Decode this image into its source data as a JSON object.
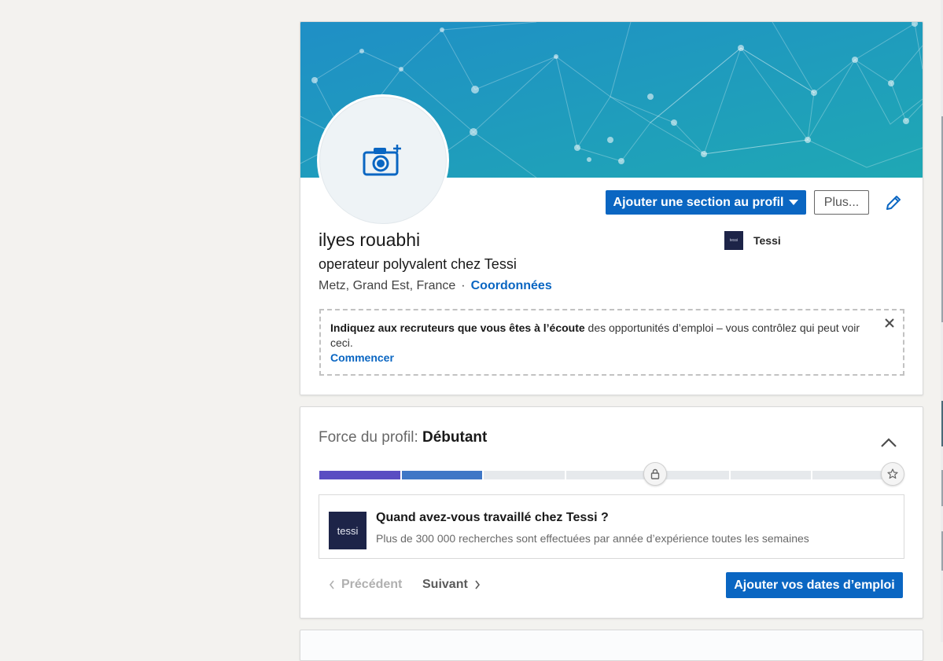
{
  "profile": {
    "name": "ilyes rouabhi",
    "headline": "operateur polyvalent chez Tessi",
    "location": "Metz, Grand Est, France",
    "separator": "·",
    "contact_label": "Coordonnées",
    "company": {
      "name": "Tessi",
      "logo_text": "tessi"
    }
  },
  "actions": {
    "add_section_label": "Ajouter une section au profil",
    "more_label": "Plus..."
  },
  "open_to_work": {
    "bold_text": "Indiquez aux recruteurs que vous êtes à l’écoute",
    "text": " des opportunités d’emploi – vous contrôlez qui peut voir ceci.",
    "link": "Commencer"
  },
  "strength": {
    "label": "Force du profil:",
    "level": "Débutant",
    "filled_segments": 2,
    "total_segments": 7,
    "colors": {
      "seg1": "#5a4dc2",
      "seg2": "#3f77c6",
      "empty": "#e6e9ec"
    },
    "suggestion": {
      "logo_text": "tessi",
      "title": "Quand avez-vous travaillé chez Tessi ?",
      "subtitle": "Plus de 300 000 recherches sont effectuées par année d’expérience toutes les semaines"
    },
    "prev_label": "Précédent",
    "next_label": "Suivant",
    "cta_label": "Ajouter vos dates d’emploi"
  },
  "icons": {
    "camera": "camera-plus-icon",
    "edit": "pencil-icon",
    "close": "close-icon",
    "collapse": "chevron-up-icon",
    "lock": "lock-icon",
    "star": "star-icon"
  },
  "theme": {
    "accent": "#0a66c2",
    "background": "#f3f2ef"
  }
}
